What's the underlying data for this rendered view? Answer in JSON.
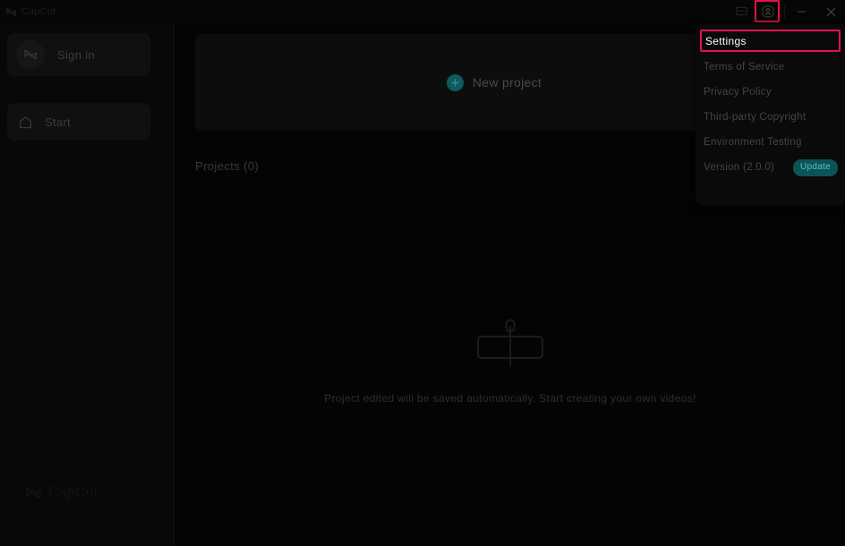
{
  "window": {
    "app_title": "CapCut",
    "titlebar_icons": [
      {
        "name": "feedback-icon",
        "label": "Feedback"
      },
      {
        "name": "account-icon",
        "label": "Account"
      }
    ],
    "minimize_label": "Minimize",
    "close_label": "Close"
  },
  "sidebar": {
    "sign_in": {
      "label": "Sign in",
      "icon": "capcut-avatar-icon"
    },
    "start": {
      "label": "Start",
      "icon": "home-icon"
    },
    "watermark": "CapCut"
  },
  "main": {
    "new_project": {
      "label": "New project",
      "icon": "plus-icon"
    },
    "projects_heading": "Projects (0)",
    "empty_state": {
      "illustration": "timeline-clip-playhead-icon",
      "text": "Project edited will be saved automatically. Start creating your own videos!"
    }
  },
  "menu": {
    "items": [
      {
        "label": "Settings",
        "highlighted": true
      },
      {
        "label": "Terms of Service",
        "highlighted": false
      },
      {
        "label": "Privacy Policy",
        "highlighted": false
      },
      {
        "label": "Third-party Copyright",
        "highlighted": false
      },
      {
        "label": "Environment Testing",
        "highlighted": false
      },
      {
        "label": "Version (2.0.0)",
        "highlighted": false
      }
    ],
    "update_badge": "Update"
  },
  "colors": {
    "highlight_border": "#e8104a",
    "accent_teal": "#0d5a5f",
    "badge_bg": "#0d5257",
    "badge_text": "#4fc6c8",
    "window_bg": "#030303",
    "sidebar_bg": "#080808",
    "menu_bg": "#0a0a0a"
  }
}
